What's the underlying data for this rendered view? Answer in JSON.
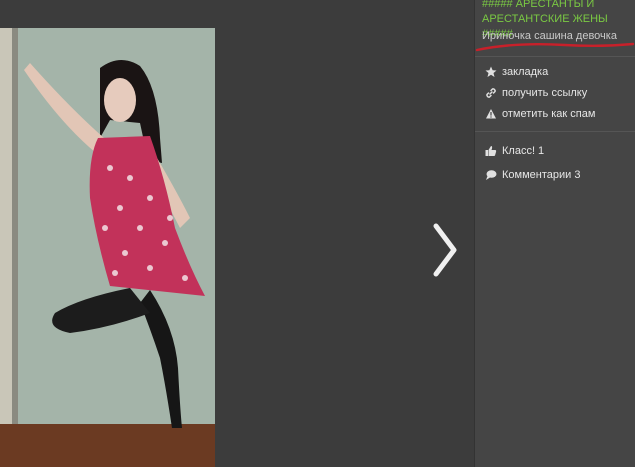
{
  "sidebar": {
    "group_title": "##### АРЕСТАНТЫ И АРЕСТАНТСКИЕ ЖЕНЫ #####",
    "album_title": "Ириночка сашина девочка",
    "actions": [
      {
        "label": "закладка",
        "icon": "star-icon"
      },
      {
        "label": "получить ссылку",
        "icon": "link-icon"
      },
      {
        "label": "отметить как спам",
        "icon": "warning-icon"
      }
    ],
    "social": [
      {
        "label": "Класс! 1",
        "icon": "thumbs-up-icon"
      },
      {
        "label": "Комментарии 3",
        "icon": "comment-icon"
      }
    ]
  },
  "colors": {
    "background": "#3c3c3c",
    "sidebar": "#454545",
    "group_link": "#7ac943",
    "underline": "#c8202a"
  }
}
